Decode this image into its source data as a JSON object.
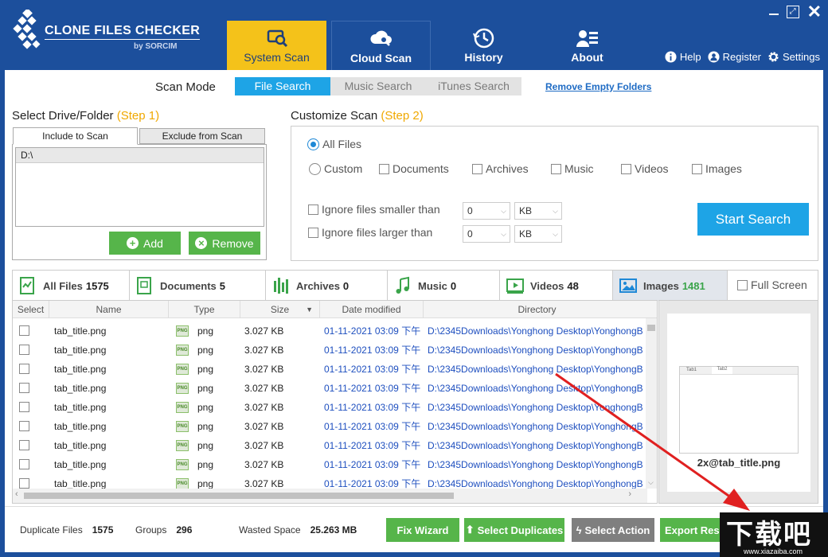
{
  "app": {
    "title_main": "CLONE FILES CHECKER",
    "title_sub": "by SORCIM"
  },
  "nav": {
    "tabs": [
      {
        "label": "System Scan",
        "icon": "system-scan-icon",
        "active": true
      },
      {
        "label": "Cloud Scan",
        "icon": "cloud-scan-icon"
      },
      {
        "label": "History",
        "icon": "history-icon"
      },
      {
        "label": "About",
        "icon": "about-icon"
      }
    ],
    "links": {
      "help": "Help",
      "register": "Register",
      "settings": "Settings"
    }
  },
  "scan_mode": {
    "label": "Scan Mode",
    "tabs": [
      "File Search",
      "Music Search",
      "iTunes Search"
    ],
    "active": "File Search",
    "remove_empty": "Remove Empty Folders"
  },
  "select_drive": {
    "title": "Select Drive/Folder",
    "step": "(Step 1)",
    "tab_include": "Include to Scan",
    "tab_exclude": "Exclude from Scan",
    "items": [
      "D:\\"
    ],
    "add_label": "Add",
    "remove_label": "Remove"
  },
  "customize": {
    "title": "Customize Scan",
    "step": "(Step 2)",
    "all_files": "All Files",
    "custom": "Custom",
    "types": [
      "Documents",
      "Archives",
      "Music",
      "Videos",
      "Images"
    ],
    "ignore_smaller": "Ignore files smaller than",
    "ignore_larger": "Ignore files larger than",
    "smaller_value": "0",
    "smaller_unit": "KB",
    "larger_value": "0",
    "larger_unit": "KB",
    "start_label": "Start Search"
  },
  "categories": [
    {
      "label": "All Files",
      "count": "1575"
    },
    {
      "label": "Documents",
      "count": "5"
    },
    {
      "label": "Archives",
      "count": "0"
    },
    {
      "label": "Music",
      "count": "0"
    },
    {
      "label": "Videos",
      "count": "48"
    },
    {
      "label": "Images",
      "count": "1481",
      "active": true
    }
  ],
  "full_screen_label": "Full Screen",
  "table": {
    "headers": {
      "select": "Select",
      "name": "Name",
      "type": "Type",
      "size": "Size",
      "date": "Date modified",
      "dir": "Directory"
    },
    "rows": [
      {
        "name": "tab_title.png",
        "type": "png",
        "size": "3.027 KB",
        "date": "01-11-2021 03:09 下午",
        "dir": "D:\\2345Downloads\\Yonghong Desktop\\YonghongB"
      },
      {
        "name": "tab_title.png",
        "type": "png",
        "size": "3.027 KB",
        "date": "01-11-2021 03:09 下午",
        "dir": "D:\\2345Downloads\\Yonghong Desktop\\YonghongB"
      },
      {
        "name": "tab_title.png",
        "type": "png",
        "size": "3.027 KB",
        "date": "01-11-2021 03:09 下午",
        "dir": "D:\\2345Downloads\\Yonghong Desktop\\YonghongB"
      },
      {
        "name": "tab_title.png",
        "type": "png",
        "size": "3.027 KB",
        "date": "01-11-2021 03:09 下午",
        "dir": "D:\\2345Downloads\\Yonghong Desktop\\YonghongB"
      },
      {
        "name": "tab_title.png",
        "type": "png",
        "size": "3.027 KB",
        "date": "01-11-2021 03:09 下午",
        "dir": "D:\\2345Downloads\\Yonghong Desktop\\YonghongB"
      },
      {
        "name": "tab_title.png",
        "type": "png",
        "size": "3.027 KB",
        "date": "01-11-2021 03:09 下午",
        "dir": "D:\\2345Downloads\\Yonghong Desktop\\YonghongB"
      },
      {
        "name": "tab_title.png",
        "type": "png",
        "size": "3.027 KB",
        "date": "01-11-2021 03:09 下午",
        "dir": "D:\\2345Downloads\\Yonghong Desktop\\YonghongB"
      },
      {
        "name": "tab_title.png",
        "type": "png",
        "size": "3.027 KB",
        "date": "01-11-2021 03:09 下午",
        "dir": "D:\\2345Downloads\\Yonghong Desktop\\YonghongB"
      },
      {
        "name": "tab_title.png",
        "type": "png",
        "size": "3.027 KB",
        "date": "01-11-2021 03:09 下午",
        "dir": "D:\\2345Downloads\\Yonghong Desktop\\YonghongB"
      }
    ],
    "type_icon_text": "PNG"
  },
  "preview": {
    "caption": "2x@tab_title.png",
    "tab1": "Tab1",
    "tab2": "Tab2"
  },
  "footer": {
    "dup_label": "Duplicate Files",
    "dup_value": "1575",
    "groups_label": "Groups",
    "groups_value": "296",
    "wasted_label": "Wasted Space",
    "wasted_value": "25.263 MB",
    "fix_wizard": "Fix Wizard",
    "select_duplicates": "Select Duplicates",
    "select_action": "Select Action",
    "export_results": "Export Resu"
  },
  "watermark": {
    "big": "下载吧",
    "small": "www.xiazaiba.com"
  },
  "colors": {
    "brand_blue": "#1c4f9c",
    "accent_yellow": "#f4c21a",
    "accent_cyan": "#1ea4e6",
    "green": "#56b54a",
    "gray_btn": "#7f7f7f",
    "arrow_red": "#e02020"
  }
}
